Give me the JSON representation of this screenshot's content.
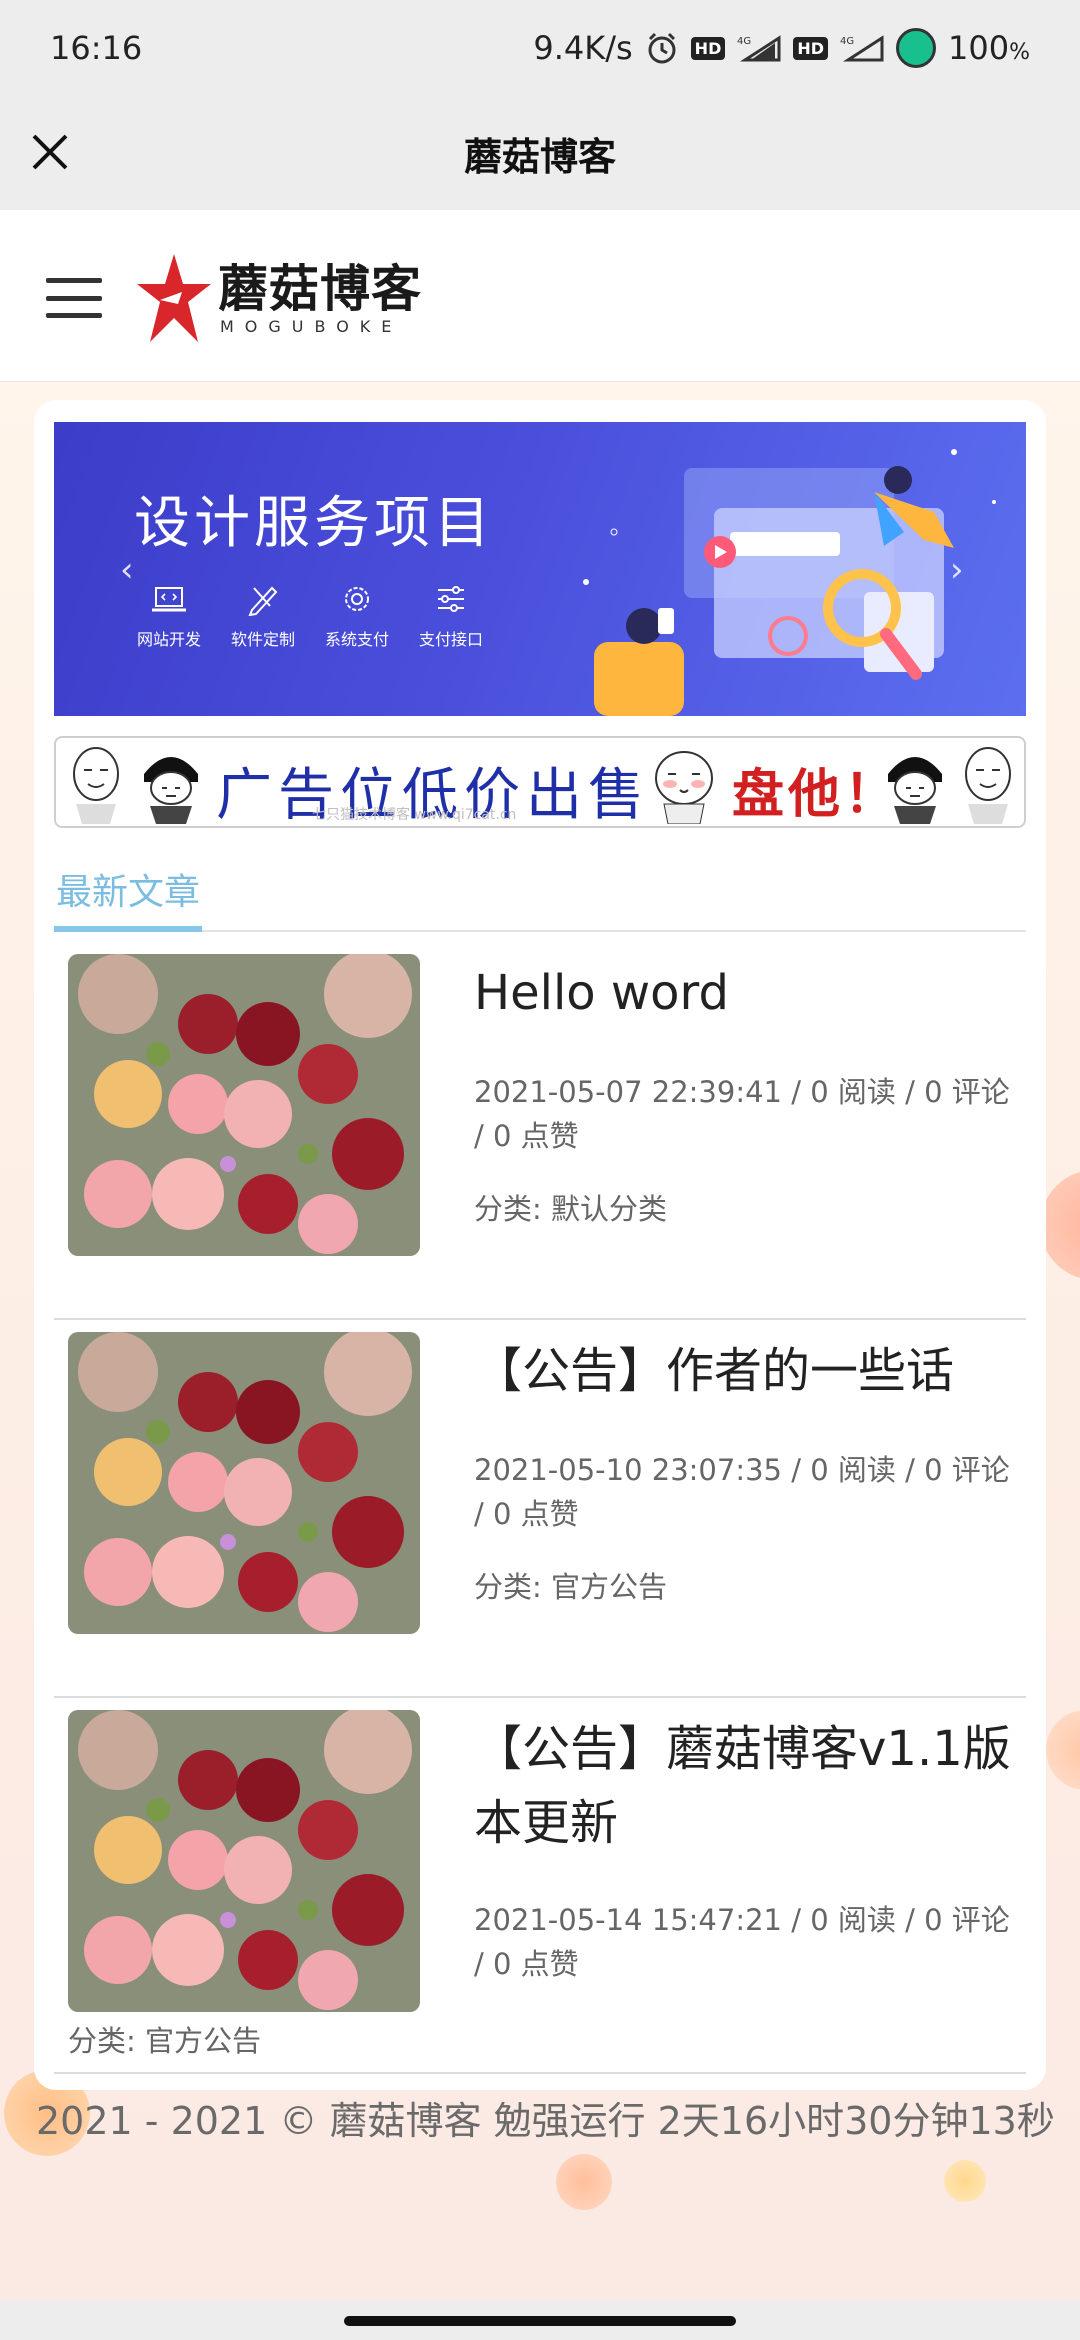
{
  "status_bar": {
    "time": "16:16",
    "speed": "9.4K/s",
    "net1": "4G",
    "net2": "4G",
    "hd": "HD",
    "battery": "100",
    "battery_unit": "%"
  },
  "titlebar": {
    "title": "蘑菇博客"
  },
  "header": {
    "logo_cn": "蘑菇博客",
    "logo_en": "MOGUBOKE"
  },
  "banner": {
    "title": "设计服务项目",
    "features": [
      "网站开发",
      "软件定制",
      "系统支付",
      "支付接口"
    ],
    "bg_color": "#4146d4"
  },
  "ad": {
    "text": "广告位低价出售",
    "highlight": "盘他！",
    "subtext": "七只猫技术博客 www.qi7cat.cn"
  },
  "section": {
    "tab": "最新文章",
    "accent": "#86c6e6"
  },
  "articles": [
    {
      "title": "Hello word",
      "meta": "2021-05-07 22:39:41 / 0 阅读 / 0 评论 / 0 点赞",
      "category": "分类: 默认分类"
    },
    {
      "title": "【公告】作者的一些话",
      "meta": "2021-05-10 23:07:35 / 0 阅读 / 0 评论 / 0 点赞",
      "category": "分类: 官方公告"
    },
    {
      "title": "【公告】蘑菇博客v1.1版本更新",
      "meta": "2021-05-14 15:47:21 / 0 阅读 / 0 评论 / 0 点赞",
      "category": "分类: 官方公告"
    }
  ],
  "footer": {
    "text": "2021 - 2021 © 蘑菇博客 勉强运行 2天16小时30分钟13秒"
  }
}
